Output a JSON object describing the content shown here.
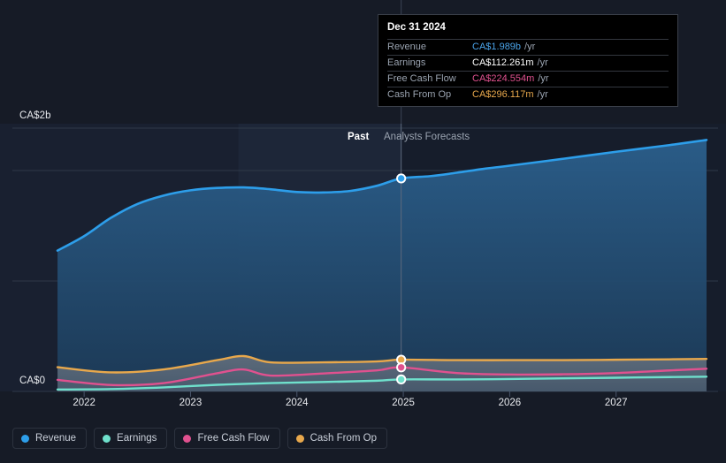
{
  "chart_data": {
    "type": "area",
    "title": "",
    "xlabel": "",
    "ylabel": "",
    "currency": "CA$",
    "grid": true,
    "legend_position": "bottom-left",
    "y_axis": {
      "ticks": [
        {
          "label": "CA$2b",
          "value": 2000
        },
        {
          "label": "CA$0",
          "value": 0
        }
      ],
      "ylim": [
        0,
        2500
      ],
      "unit": "CA$ millions"
    },
    "x_axis": {
      "ticks": [
        "2022",
        "2023",
        "2024",
        "2025",
        "2026",
        "2027"
      ],
      "xlim": [
        2021.6,
        2027.9
      ]
    },
    "phase_divider": {
      "x_value": 2024.98,
      "past_label": "Past",
      "forecast_label": "Analysts Forecasts"
    },
    "series": [
      {
        "name": "Revenue",
        "color": "#2d9eea",
        "fill": "#1d3a55",
        "x": [
          2021.75,
          2022.0,
          2022.25,
          2022.5,
          2022.75,
          2023.0,
          2023.25,
          2023.5,
          2023.75,
          2024.0,
          2024.25,
          2024.5,
          2024.75,
          2024.98,
          2025.25,
          2025.5,
          2025.75,
          2026.0,
          2026.5,
          2027.0,
          2027.5,
          2027.85
        ],
        "values": [
          1315,
          1450,
          1620,
          1750,
          1830,
          1878,
          1900,
          1905,
          1888,
          1862,
          1858,
          1872,
          1920,
          1989,
          2010,
          2042,
          2078,
          2108,
          2172,
          2238,
          2300,
          2348
        ]
      },
      {
        "name": "Earnings",
        "color": "#6fe0cc",
        "x": [
          2021.75,
          2022.25,
          2022.75,
          2023.25,
          2023.75,
          2024.25,
          2024.75,
          2024.98,
          2025.5,
          2026.0,
          2026.5,
          2027.0,
          2027.5,
          2027.85
        ],
        "values": [
          18,
          22,
          38,
          62,
          78,
          88,
          100,
          112.261,
          112,
          116,
          122,
          128,
          134,
          138
        ]
      },
      {
        "name": "Free Cash Flow",
        "color": "#e0518f",
        "x": [
          2021.75,
          2022.25,
          2022.75,
          2023.25,
          2023.5,
          2023.75,
          2024.25,
          2024.75,
          2024.98,
          2025.5,
          2026.0,
          2026.5,
          2027.0,
          2027.5,
          2027.85
        ],
        "values": [
          108,
          60,
          78,
          170,
          205,
          148,
          168,
          196,
          224.554,
          172,
          158,
          160,
          172,
          196,
          212
        ]
      },
      {
        "name": "Cash From Op",
        "color": "#e8a84c",
        "x": [
          2021.75,
          2022.25,
          2022.75,
          2023.25,
          2023.5,
          2023.75,
          2024.25,
          2024.75,
          2024.98,
          2025.5,
          2026.0,
          2026.5,
          2027.0,
          2027.5,
          2027.85
        ],
        "values": [
          226,
          178,
          206,
          292,
          330,
          272,
          272,
          280,
          296.117,
          292,
          292,
          292,
          296,
          300,
          304
        ]
      }
    ],
    "highlight_markers": [
      {
        "series": "Revenue",
        "value": 1989,
        "color": "#2d9eea"
      },
      {
        "series": "Cash From Op",
        "value": 296.117,
        "color": "#e8a84c"
      },
      {
        "series": "Free Cash Flow",
        "value": 224.554,
        "color": "#e0518f"
      },
      {
        "series": "Earnings",
        "value": 112.261,
        "color": "#6fe0cc"
      }
    ]
  },
  "tooltip": {
    "title": "Dec 31 2024",
    "rows": [
      {
        "label": "Revenue",
        "value": "CA$1.989b",
        "unit": "/yr",
        "color": "#4aa3e8"
      },
      {
        "label": "Earnings",
        "value": "CA$112.261m",
        "unit": "/yr",
        "color": "#ffffff"
      },
      {
        "label": "Free Cash Flow",
        "value": "CA$224.554m",
        "unit": "/yr",
        "color": "#e0518f"
      },
      {
        "label": "Cash From Op",
        "value": "CA$296.117m",
        "unit": "/yr",
        "color": "#e8a84c"
      }
    ]
  },
  "legend": {
    "items": [
      {
        "label": "Revenue",
        "color": "#2d9eea"
      },
      {
        "label": "Earnings",
        "color": "#6fe0cc"
      },
      {
        "label": "Free Cash Flow",
        "color": "#e0518f"
      },
      {
        "label": "Cash From Op",
        "color": "#e8a84c"
      }
    ]
  },
  "axis": {
    "y_top": "CA$2b",
    "y_bottom": "CA$0",
    "x_ticks": [
      "2022",
      "2023",
      "2024",
      "2025",
      "2026",
      "2027"
    ]
  },
  "phase": {
    "past": "Past",
    "forecast": "Analysts Forecasts"
  },
  "colors": {
    "background": "#161b26",
    "revenue": "#2d9eea",
    "earnings": "#6fe0cc",
    "free_cash_flow": "#e0518f",
    "cash_from_op": "#e8a84c",
    "gridline": "#2f3949"
  }
}
